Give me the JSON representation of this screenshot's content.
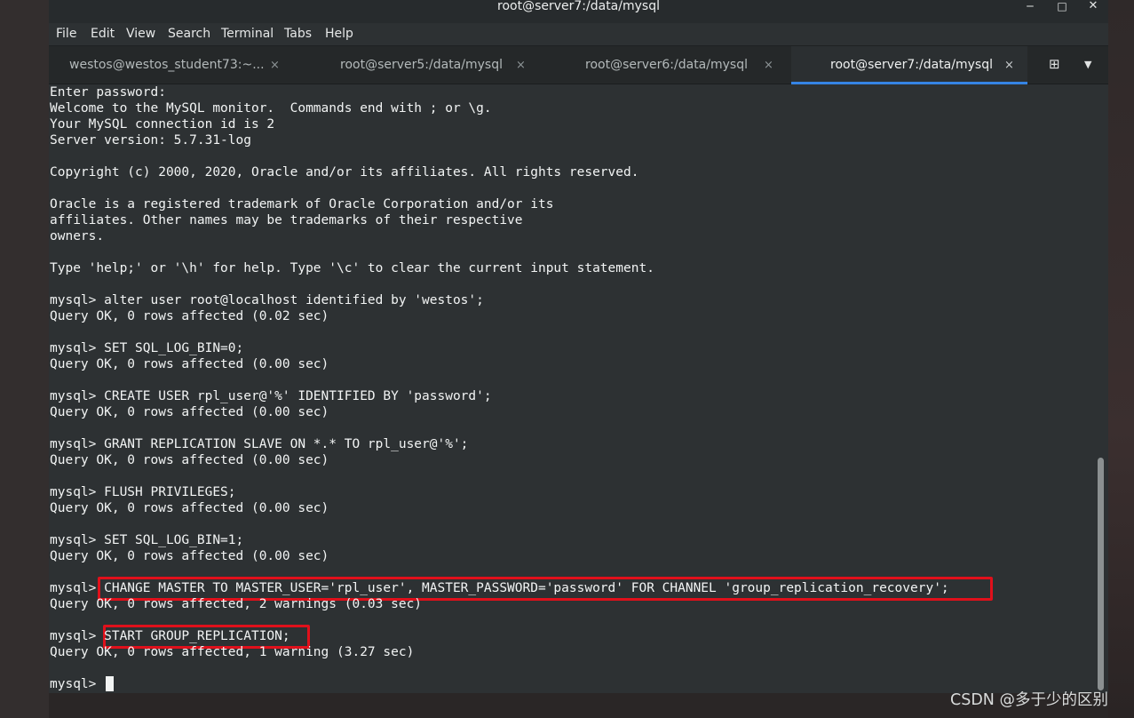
{
  "window": {
    "title": "root@server7:/data/mysql"
  },
  "window_controls": {
    "minimize": "‒",
    "maximize": "□",
    "close": "✕"
  },
  "menu": [
    "File",
    "Edit",
    "View",
    "Search",
    "Terminal",
    "Tabs",
    "Help"
  ],
  "tabs": [
    {
      "label": "westos@westos_student73:~...",
      "active": false
    },
    {
      "label": "root@server5:/data/mysql",
      "active": false
    },
    {
      "label": "root@server6:/data/mysql",
      "active": false
    },
    {
      "label": "root@server7:/data/mysql",
      "active": true
    }
  ],
  "tab_close_glyph": "×",
  "tab_actions": {
    "new_tab_icon": "new-tab-icon",
    "menu_icon": "chevron-down-icon",
    "new_tab_glyph": "⊞",
    "menu_glyph": "▼"
  },
  "terminal": {
    "lines": [
      "Enter password:",
      "Welcome to the MySQL monitor.  Commands end with ; or \\g.",
      "Your MySQL connection id is 2",
      "Server version: 5.7.31-log",
      "",
      "Copyright (c) 2000, 2020, Oracle and/or its affiliates. All rights reserved.",
      "",
      "Oracle is a registered trademark of Oracle Corporation and/or its",
      "affiliates. Other names may be trademarks of their respective",
      "owners.",
      "",
      "Type 'help;' or '\\h' for help. Type '\\c' to clear the current input statement.",
      "",
      "mysql> alter user root@localhost identified by 'westos';",
      "Query OK, 0 rows affected (0.02 sec)",
      "",
      "mysql> SET SQL_LOG_BIN=0;",
      "Query OK, 0 rows affected (0.00 sec)",
      "",
      "mysql> CREATE USER rpl_user@'%' IDENTIFIED BY 'password';",
      "Query OK, 0 rows affected (0.00 sec)",
      "",
      "mysql> GRANT REPLICATION SLAVE ON *.* TO rpl_user@'%';",
      "Query OK, 0 rows affected (0.00 sec)",
      "",
      "mysql> FLUSH PRIVILEGES;",
      "Query OK, 0 rows affected (0.00 sec)",
      "",
      "mysql> SET SQL_LOG_BIN=1;",
      "Query OK, 0 rows affected (0.00 sec)",
      "",
      "mysql> CHANGE MASTER TO MASTER_USER='rpl_user', MASTER_PASSWORD='password' FOR CHANNEL 'group_replication_recovery';",
      "Query OK, 0 rows affected, 2 warnings (0.03 sec)",
      "",
      "mysql> START GROUP_REPLICATION;",
      "Query OK, 0 rows affected, 1 warning (3.27 sec)",
      "",
      "mysql> "
    ]
  },
  "highlights": [
    {
      "text": "CHANGE MASTER TO MASTER_USER='rpl_user', MASTER_PASSWORD='password' FOR CHANNEL 'group_replication_recovery';",
      "color": "#e0101b"
    },
    {
      "text": "START GROUP_REPLICATION;",
      "color": "#e0101b"
    }
  ],
  "watermark": "CSDN @多于少的区别"
}
